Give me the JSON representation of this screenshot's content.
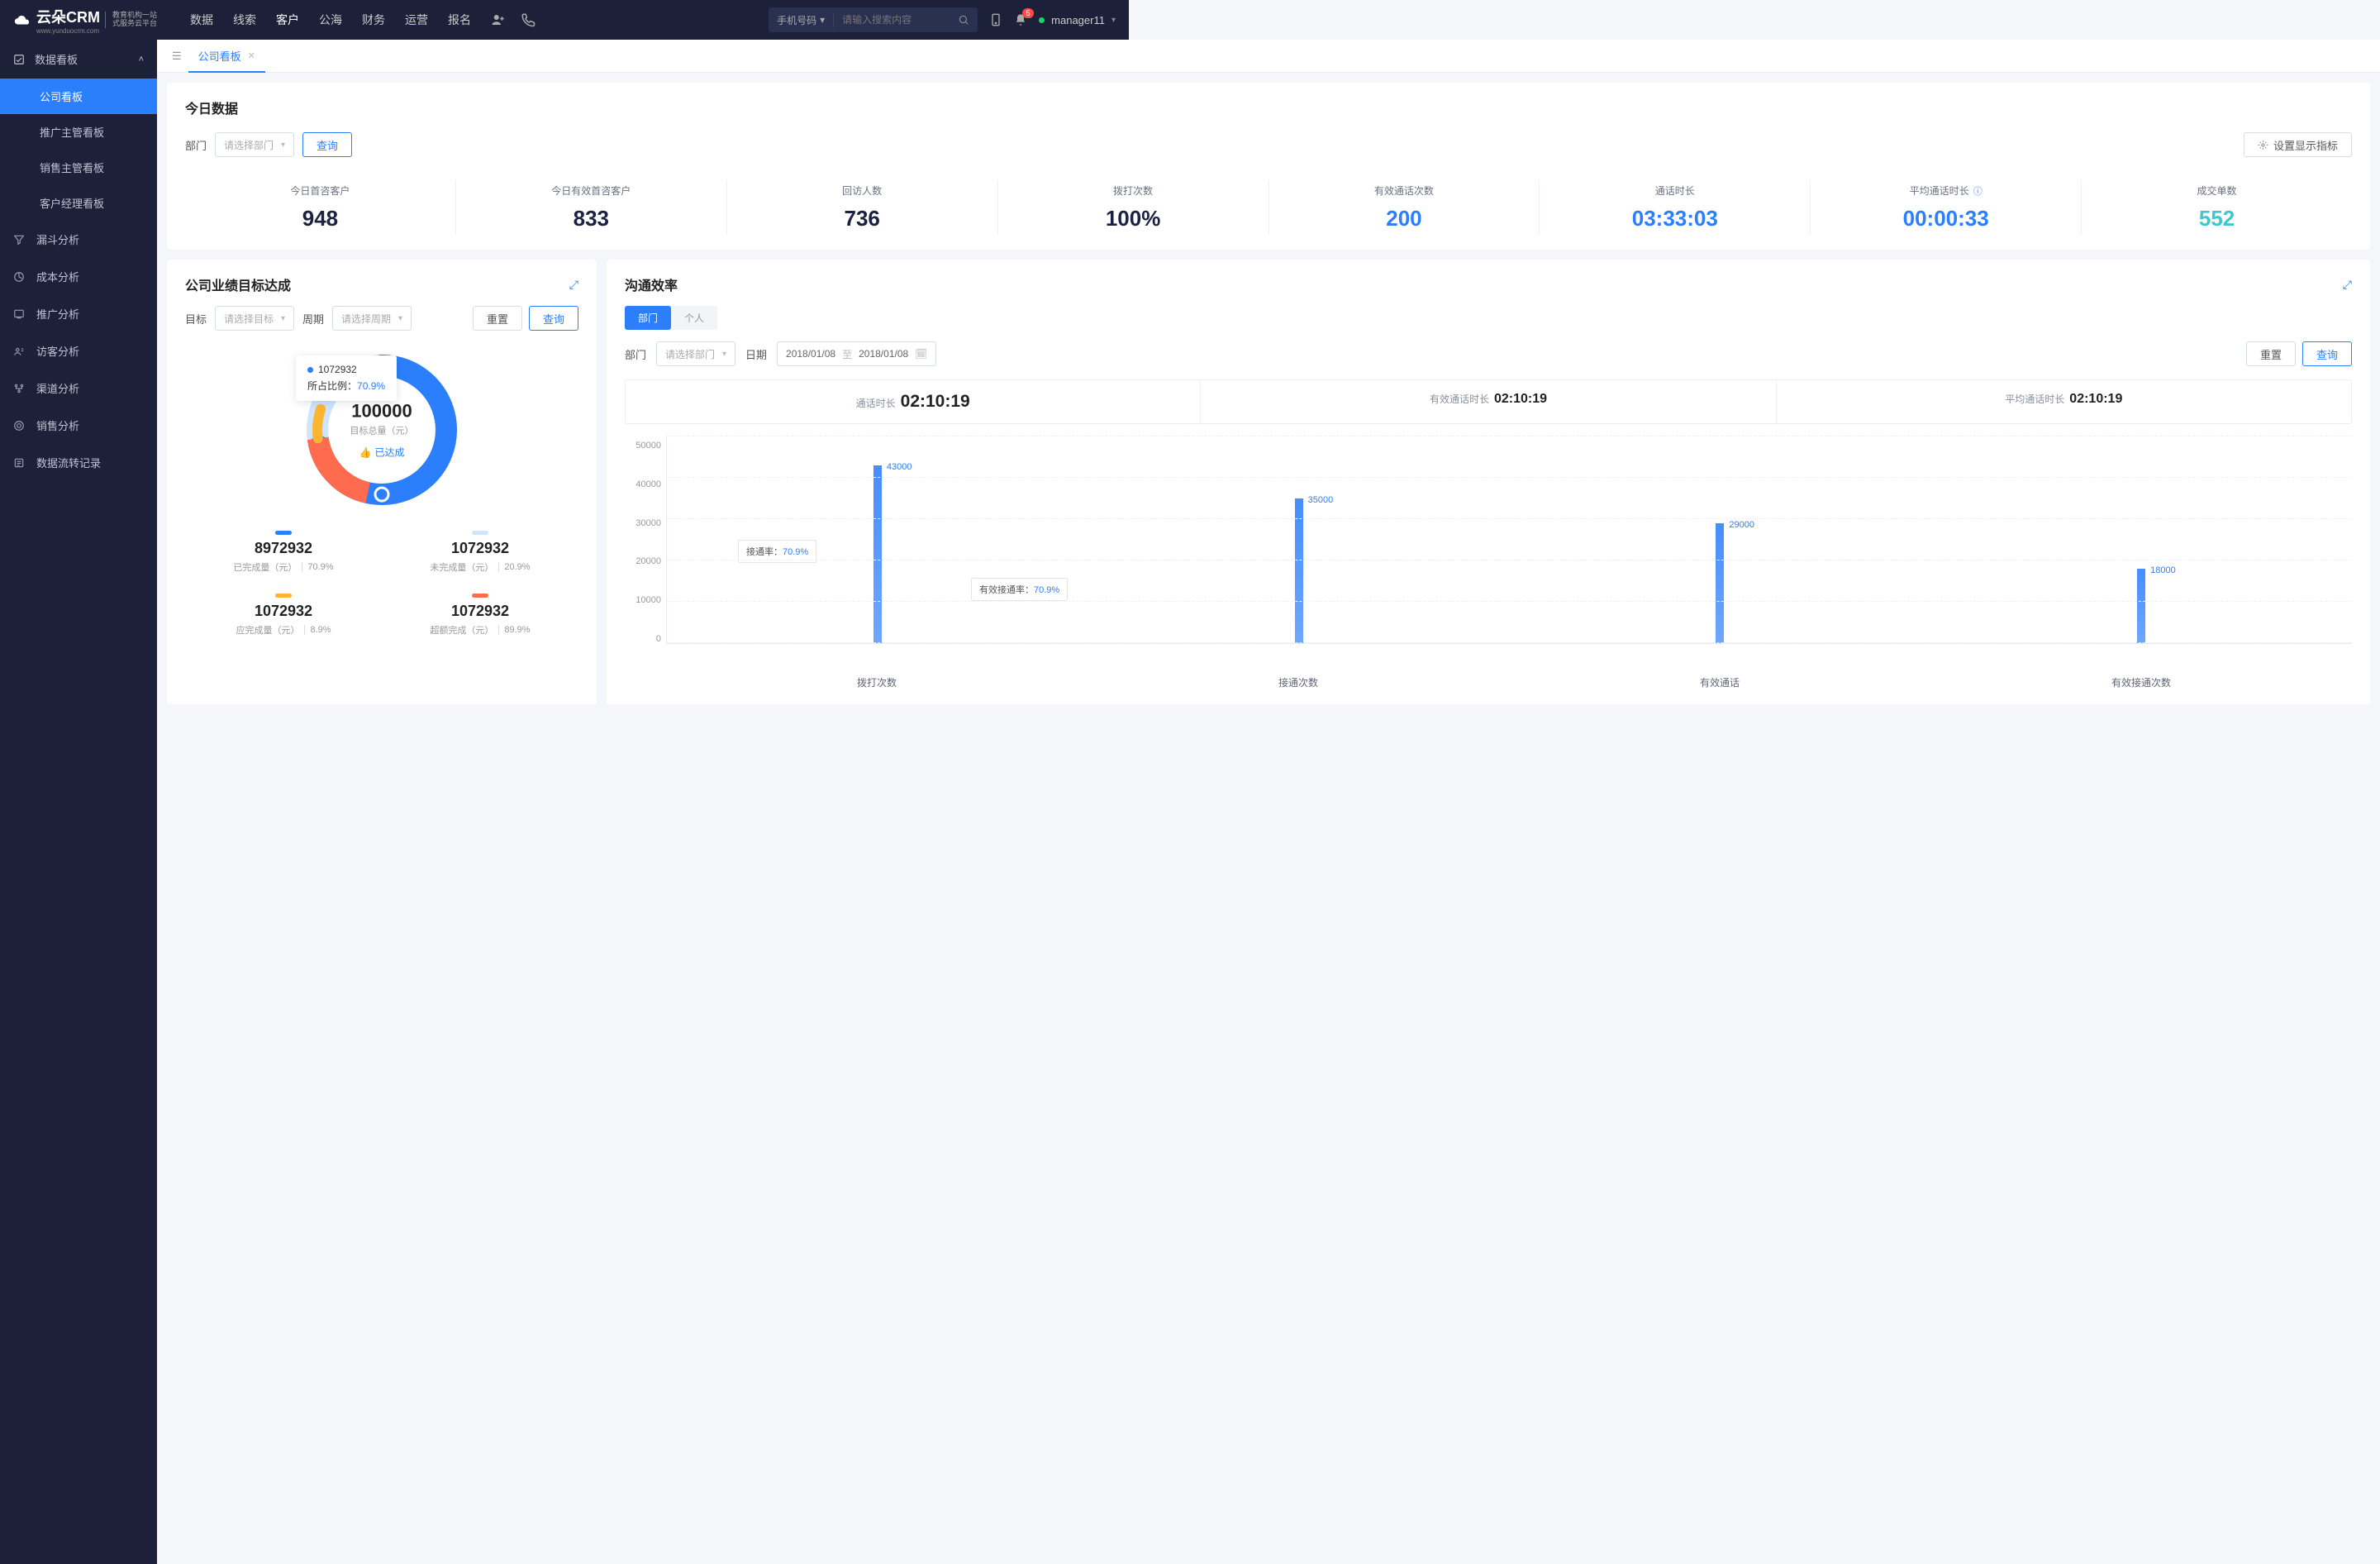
{
  "brand": {
    "name": "云朵CRM",
    "sub1": "教育机构一站",
    "sub2": "式服务云平台",
    "url": "www.yunduocrm.com"
  },
  "nav": [
    "数据",
    "线索",
    "客户",
    "公海",
    "财务",
    "运营",
    "报名"
  ],
  "nav_active": 2,
  "search": {
    "type_label": "手机号码",
    "placeholder": "请输入搜索内容"
  },
  "notif_count": "5",
  "user": "manager11",
  "sidebar": {
    "group_title": "数据看板",
    "group_items": [
      "公司看板",
      "推广主管看板",
      "销售主管看板",
      "客户经理看板"
    ],
    "active_index": 0,
    "singles": [
      {
        "icon": "filter",
        "label": "漏斗分析"
      },
      {
        "icon": "cost",
        "label": "成本分析"
      },
      {
        "icon": "promo",
        "label": "推广分析"
      },
      {
        "icon": "visitor",
        "label": "访客分析"
      },
      {
        "icon": "channel",
        "label": "渠道分析"
      },
      {
        "icon": "sales",
        "label": "销售分析"
      },
      {
        "icon": "flow",
        "label": "数据流转记录"
      }
    ]
  },
  "tab": {
    "label": "公司看板"
  },
  "today": {
    "title": "今日数据",
    "dept_label": "部门",
    "dept_placeholder": "请选择部门",
    "query": "查询",
    "settings": "设置显示指标",
    "metrics": [
      {
        "label": "今日首咨客户",
        "value": "948",
        "color": "c-dark"
      },
      {
        "label": "今日有效首咨客户",
        "value": "833",
        "color": "c-dark"
      },
      {
        "label": "回访人数",
        "value": "736",
        "color": "c-dark"
      },
      {
        "label": "拨打次数",
        "value": "100%",
        "color": "c-dark"
      },
      {
        "label": "有效通话次数",
        "value": "200",
        "color": "c-blue"
      },
      {
        "label": "通话时长",
        "value": "03:33:03",
        "color": "c-blue"
      },
      {
        "label": "平均通话时长",
        "value": "00:00:33",
        "color": "c-blue",
        "info": true
      },
      {
        "label": "成交单数",
        "value": "552",
        "color": "c-cyan"
      }
    ]
  },
  "goal": {
    "title": "公司业绩目标达成",
    "target_label": "目标",
    "target_placeholder": "请选择目标",
    "period_label": "周期",
    "period_placeholder": "请选择周期",
    "reset": "重置",
    "query": "查询",
    "center_value": "100000",
    "center_sub": "目标总量（元）",
    "achieved": "已达成",
    "tooltip_value": "1072932",
    "tooltip_pct_label": "所占比例：",
    "tooltip_pct": "70.9%",
    "legend": [
      {
        "color": "#2b7efc",
        "value": "8972932",
        "label": "已完成量（元）",
        "pct": "70.9%"
      },
      {
        "color": "#cfe4ff",
        "value": "1072932",
        "label": "未完成量（元）",
        "pct": "20.9%"
      },
      {
        "color": "#fcb52f",
        "value": "1072932",
        "label": "应完成量（元）",
        "pct": "8.9%"
      },
      {
        "color": "#ff6b4f",
        "value": "1072932",
        "label": "超额完成（元）",
        "pct": "89.9%"
      }
    ]
  },
  "comm": {
    "title": "沟通效率",
    "tabs": [
      "部门",
      "个人"
    ],
    "dept_label": "部门",
    "dept_placeholder": "请选择部门",
    "date_label": "日期",
    "date_from": "2018/01/08",
    "date_to": "2018/01/08",
    "date_sep": "至",
    "reset": "重置",
    "query": "查询",
    "stats": [
      {
        "label": "通话时长",
        "value": "02:10:19",
        "big": true
      },
      {
        "label": "有效通话时长",
        "value": "02:10:19"
      },
      {
        "label": "平均通话时长",
        "value": "02:10:19"
      }
    ],
    "anno1": {
      "label": "接通率：",
      "pct": "70.9%"
    },
    "anno2": {
      "label": "有效接通率：",
      "pct": "70.9%"
    }
  },
  "chart_data": {
    "type": "bar",
    "categories": [
      "拨打次数",
      "接通次数",
      "有效通话",
      "有效接通次数"
    ],
    "values": [
      43000,
      35000,
      29000,
      18000
    ],
    "ylim": [
      0,
      50000
    ],
    "yticks": [
      0,
      10000,
      20000,
      30000,
      40000,
      50000
    ]
  }
}
